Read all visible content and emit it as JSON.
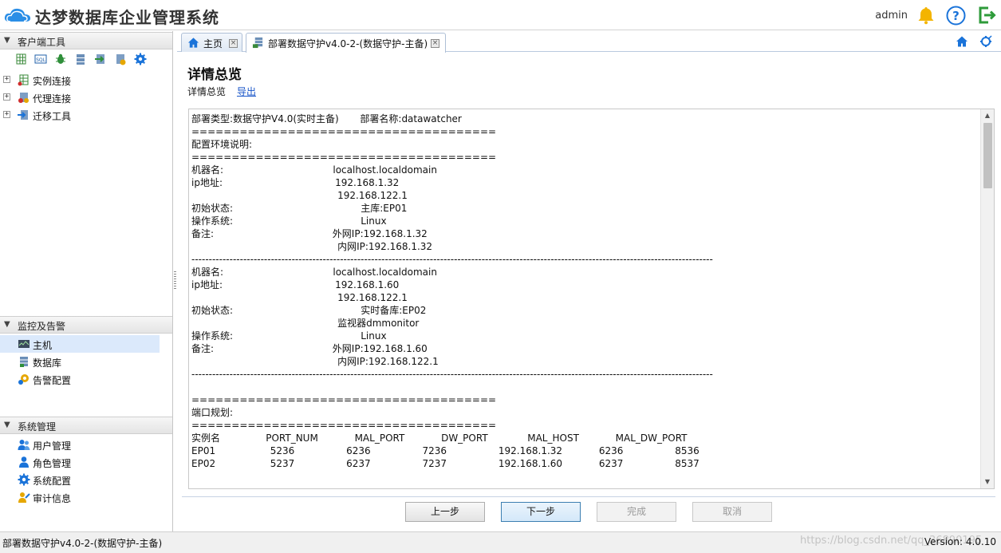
{
  "app": {
    "title": "达梦数据库企业管理系统",
    "user": "admin"
  },
  "sidebar": {
    "client_tools": {
      "header": "客户端工具",
      "toolbar_icons": [
        "instance-grid-icon",
        "sql-icon",
        "bug-icon",
        "server-icon",
        "transfer-icon",
        "server-config-icon",
        "settings-gear-icon"
      ],
      "tree": [
        {
          "label": "实例连接",
          "icon": "instance-connection-icon"
        },
        {
          "label": "代理连接",
          "icon": "proxy-connection-icon"
        },
        {
          "label": "迁移工具",
          "icon": "migration-tool-icon"
        }
      ]
    },
    "monitor": {
      "header": "监控及告警",
      "items": [
        {
          "label": "主机",
          "icon": "host-monitor-icon",
          "active": true
        },
        {
          "label": "数据库",
          "icon": "database-icon",
          "active": false
        },
        {
          "label": "告警配置",
          "icon": "alarm-config-icon",
          "active": false
        }
      ]
    },
    "system": {
      "header": "系统管理",
      "items": [
        {
          "label": "用户管理",
          "icon": "users-icon"
        },
        {
          "label": "角色管理",
          "icon": "role-icon"
        },
        {
          "label": "系统配置",
          "icon": "system-gear-icon"
        },
        {
          "label": "审计信息",
          "icon": "audit-icon"
        }
      ]
    }
  },
  "tabs": [
    {
      "label": "主页",
      "icon": "home-icon"
    },
    {
      "label": "部署数据守护v4.0-2-(数据守护-主备)",
      "icon": "deploy-icon",
      "active": true
    }
  ],
  "main": {
    "title": "详情总览",
    "breadcrumb": "详情总览",
    "export_link": "导出",
    "detail_text": "部署类型:数据守护V4.0(实时主备)       部署名称:datawatcher\n======================================\n配置环境说明:\n======================================\n机器名:                                    localhost.localdomain\nip地址:                                     192.168.1.32\n                                                192.168.122.1\n初始状态:                                          主库:EP01\n操作系统:                                          Linux\n备注:                                       外网IP:192.168.1.32\n                                                内网IP:192.168.1.32\n-------------------------------------------------------------------------------------------------------------------------------------------------------\n机器名:                                    localhost.localdomain\nip地址:                                     192.168.1.60\n                                                192.168.122.1\n初始状态:                                          实时备库:EP02\n                                                监视器dmmonitor\n操作系统:                                          Linux\n备注:                                       外网IP:192.168.1.60\n                                                内网IP:192.168.122.1\n-------------------------------------------------------------------------------------------------------------------------------------------------------\n\n======================================\n端口规划:\n======================================\n实例名               PORT_NUM            MAL_PORT            DW_PORT             MAL_HOST            MAL_DW_PORT\nEP01                  5236                 6236                 7236                 192.168.1.32            6236                 8536\nEP02                  5237                 6237                 7237                 192.168.1.60            6237                 8537\n\n--------------------------------------------------------"
  },
  "buttons": {
    "prev": "上一步",
    "next": "下一步",
    "finish": "完成",
    "cancel": "取消"
  },
  "status": {
    "left": "部署数据守护v4.0-2-(数据守护-主备)",
    "watermark": "https://blog.csdn.net/qq_36890195",
    "version": "Version: 4.0.10"
  },
  "colors": {
    "accent_blue": "#1a73d9",
    "bell_yellow": "#f3b400",
    "logout_green": "#2e9b3a",
    "link_blue": "#1a56c9"
  }
}
